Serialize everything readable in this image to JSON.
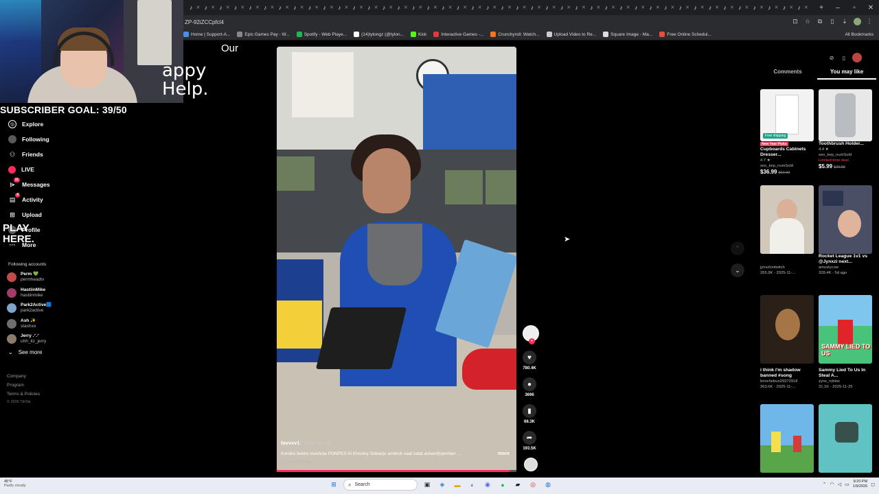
{
  "browser": {
    "url": "ZP-92iZCCpfcl4",
    "bookmarks": [
      {
        "label": "Home | Support-A...",
        "color": "#4a8fe7"
      },
      {
        "label": "Epic Games Pay - W...",
        "color": "#888888"
      },
      {
        "label": "Spotify - Web Playe...",
        "color": "#1db954"
      },
      {
        "label": "(14)tylongz (@tylon...",
        "color": "#ffffff"
      },
      {
        "label": "Kick",
        "color": "#53fc18"
      },
      {
        "label": "Interactive Games -...",
        "color": "#e03a3a"
      },
      {
        "label": "Crunchyroll: Watch...",
        "color": "#f47521"
      },
      {
        "label": "Upload Video to Re...",
        "color": "#cccccc"
      },
      {
        "label": "Square Image - Ma...",
        "color": "#dddddd"
      },
      {
        "label": "Free Online Schedul...",
        "color": "#e84c3d"
      }
    ],
    "all_bookmarks": "All Bookmarks"
  },
  "overlay": {
    "subscriber_goal": "SUBSCRIBER GOAL: 39/50"
  },
  "nav": {
    "items": [
      {
        "label": "Explore",
        "icon": "compass-icon"
      },
      {
        "label": "Following",
        "icon": "following-avatar-icon"
      },
      {
        "label": "Friends",
        "icon": "friends-icon"
      },
      {
        "label": "LIVE",
        "icon": "live-icon"
      },
      {
        "label": "Messages",
        "icon": "messages-icon",
        "badge": "11"
      },
      {
        "label": "Activity",
        "icon": "activity-icon",
        "badge": "4"
      },
      {
        "label": "Upload",
        "icon": "upload-icon"
      },
      {
        "label": "Profile",
        "icon": "profile-icon"
      },
      {
        "label": "More",
        "icon": "more-icon"
      }
    ],
    "following_title": "Following accounts",
    "accounts": [
      {
        "name": "Perm 💚",
        "handle": "permheadtv",
        "color": "#c44a4a"
      },
      {
        "name": "HastiinMike",
        "handle": "hastiinmike",
        "color": "#a23d6b"
      },
      {
        "name": "Park2Active🟦",
        "handle": "park2active",
        "color": "#7fa3c9"
      },
      {
        "name": "Ash ✨",
        "handle": "stashxo",
        "color": "#6e6e6e"
      },
      {
        "name": "Jerry .ᐟ.ᐟ",
        "handle": "uhh_itz_jerry",
        "color": "#8d7b6a"
      }
    ],
    "see_more": "See more",
    "footer": [
      "Company",
      "Program",
      "Terms & Policies"
    ],
    "copyright": "© 2026 TikTok"
  },
  "video": {
    "sign_text": "appy\nHelp.",
    "sign_our": "Our",
    "play_here": "PLAY\nHERE.",
    "username": "favvxv1",
    "date": "2025-12-29",
    "caption": "Kondisi terkini mushola PONPES Al Khoziny Sidoarjo ambruk saat salat ashar#jtvjember ...",
    "more": "more",
    "see_translation": "See translation",
    "progress": 0.97,
    "likes": "780.4K",
    "comments": "3696",
    "saves": "68.3K",
    "shares": "193.5K"
  },
  "right_panel": {
    "tabs": [
      "Comments",
      "You may like"
    ],
    "active_tab": "You may like",
    "cards": [
      {
        "tag": "New Year Picks",
        "title": "Cupboards Cabinets Dresser...",
        "meta": "4.7 ★",
        "seller": "seo_kep_numSold",
        "price": "$36.99",
        "old_price": "$60.99",
        "pill": "Free shipping"
      },
      {
        "title": "Toothbrush Holder...",
        "meta": "4.4 ★",
        "seller": "seo_kep_numSold",
        "limited": "Limited time deal",
        "price": "$5.99",
        "old_price": "$29.99"
      },
      {
        "author": "jynxzlontwitch",
        "stats": "265.9K · 2025-11-..."
      },
      {
        "title": "Rocket League 1v1 vs @Jynxzi next...",
        "author": "amustycow",
        "stats": "328.4K · 5d ago"
      },
      {
        "title": "i think i'm shadow banned #song",
        "author": "briochebun29372918",
        "stats": "363.6K · 2025-11-..."
      },
      {
        "title": "Sammy Lied To Us In Steal A...",
        "author": "zynx_roblox",
        "stats": "31.1K · 2025-11-25",
        "thumb_text": "SAMMY LIED TO US"
      },
      {
        "thumb_text": ""
      },
      {
        "thumb_text": ""
      }
    ]
  },
  "taskbar": {
    "temp": "45°F",
    "weather": "Partly cloudy",
    "search": "Search",
    "time": "8:20 PM",
    "date": "1/9/2026"
  }
}
